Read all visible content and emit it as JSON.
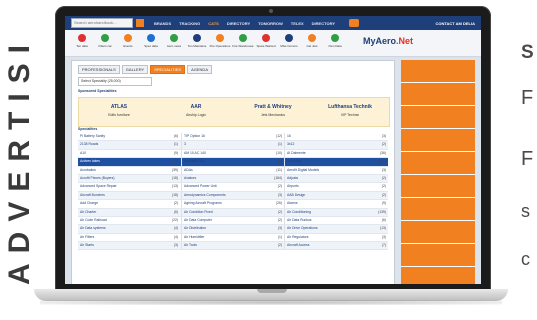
{
  "side_word": "ADVERTISI",
  "right_text": {
    "t1": "S",
    "t2": "F",
    "t3": "F",
    "t4": "s",
    "t5": "c"
  },
  "site": {
    "search_placeholder": "Search aerohandbook...",
    "nav": [
      "BRANDS",
      "TRACKING",
      "CATS",
      "DIRECTORY",
      "TOMORROW",
      "TELEX",
      "DIRECTORY"
    ],
    "active_nav_index": 2,
    "account": "CONTACT AM DELIA",
    "logo_main": "MyAero",
    "logo_accent": ".Net",
    "colors": {
      "nav_bg": "#1f3f7a",
      "accent": "#f08020",
      "highlight_row": "#1f4fa0"
    }
  },
  "icons": [
    {
      "name": "Ten data",
      "color": "#e03030"
    },
    {
      "name": "Filters cat",
      "color": "#2f9e44"
    },
    {
      "name": "Events",
      "color": "#f08020"
    },
    {
      "name": "Spec data",
      "color": "#1f6fd0"
    },
    {
      "name": "Aero news",
      "color": "#2f9e44"
    },
    {
      "name": "Ten Maintains",
      "color": "#1f3f7a"
    },
    {
      "name": "Fire Operations",
      "color": "#f08020"
    },
    {
      "name": "Fire Warehouse",
      "color": "#2f9e44"
    },
    {
      "name": "Spare Wanted",
      "color": "#e03030"
    },
    {
      "name": "Miss Comms",
      "color": "#1f3f7a"
    },
    {
      "name": "Cat Jets",
      "color": "#f08020"
    },
    {
      "name": "Own Data",
      "color": "#2f9e44"
    }
  ],
  "tabs": [
    {
      "label": "PROFESSIONALS",
      "selected": false
    },
    {
      "label": "GALLERY",
      "selected": false
    },
    {
      "label": "SPECIALITIES",
      "selected": true
    },
    {
      "label": "AGENDA",
      "selected": false
    }
  ],
  "filter_select": "Select Speciality (25,000)",
  "sponsored_heading": "Sponsored Specialities",
  "specialities_heading": "Specialities",
  "sponsors": [
    {
      "logo": "ATLAS",
      "caption": "Edits furniture"
    },
    {
      "logo": "AAR",
      "caption": "Airship Logic"
    },
    {
      "logo": "Pratt & Whitney",
      "caption": "Jets Mechanics"
    },
    {
      "logo": "Lufthansa Technik",
      "caption": "VIP Technic"
    }
  ],
  "rows": [
    [
      [
        "Pl Battery Sanity",
        "(6)"
      ],
      [
        "TIP Option 16",
        "(12)"
      ],
      [
        "16",
        "(3)"
      ]
    ],
    [
      [
        "2138 Roads",
        "(1)"
      ],
      [
        "3",
        "(1)"
      ],
      [
        "3x12",
        "(2)"
      ]
    ],
    [
      [
        "A10",
        "(9)"
      ],
      [
        "AM 10 AC 140",
        "(10)"
      ],
      [
        "AI Dalmente",
        "(36)"
      ]
    ],
    [
      [
        "Actives takes",
        "(7)"
      ],
      [
        "Acrofight Ops",
        "(5)"
      ],
      [
        "Actuators",
        "(107)"
      ]
    ],
    [
      [
        "Acrobatics",
        "(39)"
      ],
      [
        "ADAs",
        "(11)"
      ],
      [
        "Aerofit Digital Models",
        "(3)"
      ]
    ],
    [
      [
        "Acrofit Pieces (Buyers)",
        "(18)"
      ],
      [
        "Aviators",
        "(184)"
      ],
      [
        "Adjusts",
        "(2)"
      ]
    ],
    [
      [
        "Advanced Space Repair",
        "(13)"
      ],
      [
        "Advanced Power Unit",
        "(2)"
      ],
      [
        "Airports",
        "(2)"
      ]
    ],
    [
      [
        "Aircraft Bunches",
        "(18)"
      ],
      [
        "Aerodynamics Components",
        "(3)"
      ],
      [
        "AAB Design",
        "(2)"
      ]
    ],
    [
      [
        "Add Charge",
        "(2)"
      ],
      [
        "Ageing Aircraft Programs",
        "(26)"
      ],
      [
        "Alarms",
        "(9)"
      ]
    ],
    [
      [
        "Air Charter",
        "(6)"
      ],
      [
        "Air Condition Fixed",
        "(2)"
      ],
      [
        "Air Conditioning",
        "(139)"
      ]
    ],
    [
      [
        "Air Code Railroad",
        "(22)"
      ],
      [
        "Air Data Computer",
        "(2)"
      ],
      [
        "Air Data Ruckus",
        "(6)"
      ]
    ],
    [
      [
        "Air Data systems",
        "(4)"
      ],
      [
        "Air Distribution",
        "(3)"
      ],
      [
        "Air Drive Operations",
        "(13)"
      ]
    ],
    [
      [
        "Air Filters",
        "(4)"
      ],
      [
        "Air Humidifier",
        "(1)"
      ],
      [
        "Air Regulators",
        "(3)"
      ]
    ],
    [
      [
        "Air Starts",
        "(3)"
      ],
      [
        "Air Tools",
        "(2)"
      ],
      [
        "Aircraft Access",
        "(7)"
      ]
    ]
  ],
  "highlighted_row_index": 3
}
